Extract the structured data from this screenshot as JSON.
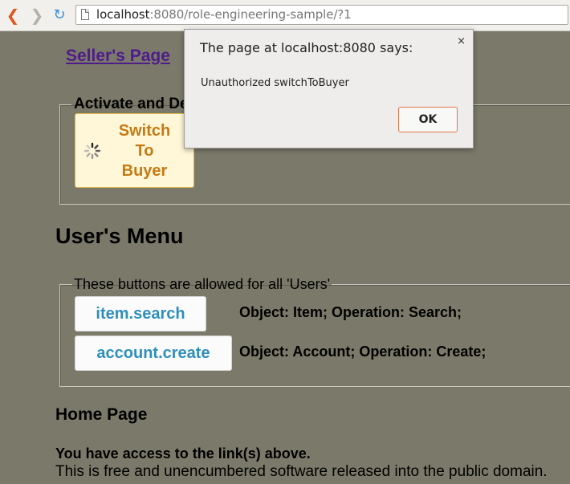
{
  "browser": {
    "url_host": "localhost",
    "url_rest": ":8080/role-engineering-sample/?1"
  },
  "page": {
    "seller_link": "Seller's Page",
    "activate_legend": "Activate and De",
    "switch_button": [
      "Switch",
      "To",
      "Buyer"
    ],
    "users_menu_title": "User's Menu",
    "users_legend": "These buttons are allowed for all 'Users'",
    "buttons": [
      {
        "label": "item.search",
        "description": "Object: Item; Operation: Search;"
      },
      {
        "label": "account.create",
        "description": "Object: Account; Operation: Create;"
      }
    ],
    "home_title": "Home Page",
    "access_text": "You have access to the link(s) above.",
    "license_text": "This is free and unencumbered software released into the public domain."
  },
  "dialog": {
    "title": "The page at localhost:8080 says:",
    "message": "Unauthorized switchToBuyer",
    "ok_label": "OK",
    "close_glyph": "×"
  },
  "colors": {
    "page_bg": "#7b7a6a",
    "link": "#4f1c8b",
    "switch_text": "#c67a14",
    "action_text": "#2e8fbd",
    "ok_border": "#e0764a"
  },
  "icons": {
    "back": "back-arrow-icon",
    "forward": "forward-arrow-icon",
    "reload": "reload-icon",
    "page": "page-icon",
    "spinner": "loading-spinner-icon"
  }
}
